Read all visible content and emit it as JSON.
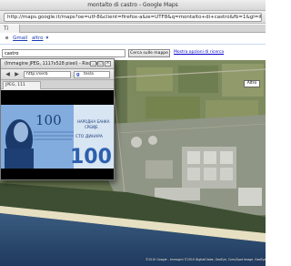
{
  "browser": {
    "window_title": "montalto di castro - Google Maps",
    "url": "http://maps.google.it/maps?oe=utf-8&client=firefox-a&ie=UTF8&q=montalto+di+castro&fb=1&gl=it&hl=it&ll=",
    "tab_label": "Ti"
  },
  "gbar": {
    "links": [
      "Gmail",
      "altro"
    ],
    "prefix": "e"
  },
  "search": {
    "value": "castro",
    "button_label": "Cerca sulle mappe",
    "options_label": "Mostra opzioni di ricerca"
  },
  "map": {
    "type_button": "Altro",
    "copyright": "©2010 Google - Immagini ©2010 DigitalGlobe, GeoEye, Cnes/Spot Image, GeoEye, Map data ©2010"
  },
  "popup": {
    "title": "(Immagine JPEG, 1117x528 pixel) - Riscalata",
    "url": "http://serb",
    "search_label": "tesla",
    "tab_label": "JPEG, 111",
    "banknote": {
      "denomination": "100",
      "denomination_large": "100",
      "bank_name_line1": "НАРОДНА БАНКА",
      "bank_name_line2": "СРБИЈЕ",
      "word": "СТО ДИНАРА"
    }
  },
  "colors": {
    "sea": "#2c4a72",
    "land": "#66744f",
    "banknote_blue": "#3d6fb8",
    "popup_bg": "#e6e6e6"
  }
}
